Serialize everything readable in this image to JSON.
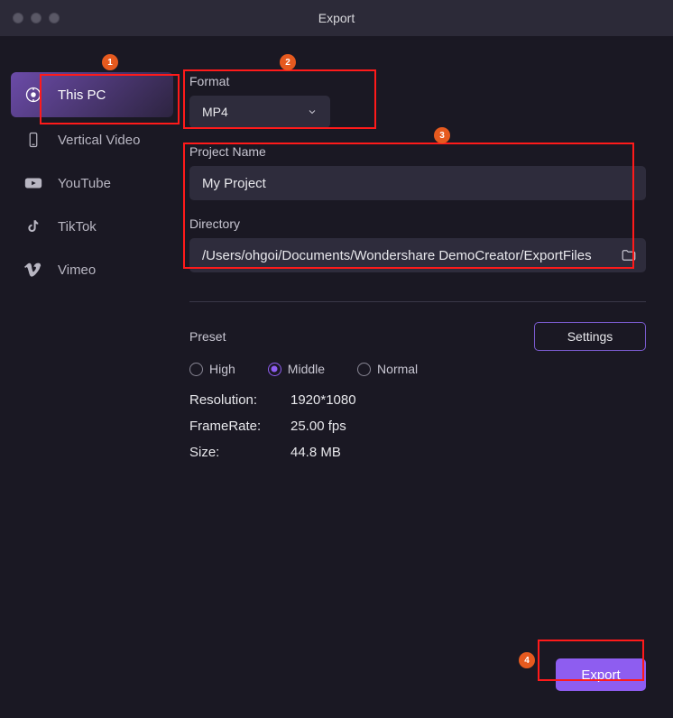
{
  "window": {
    "title": "Export"
  },
  "sidebar": {
    "items": [
      {
        "label": "This PC",
        "icon": "disk",
        "active": true
      },
      {
        "label": "Vertical Video",
        "icon": "phone",
        "active": false
      },
      {
        "label": "YouTube",
        "icon": "youtube",
        "active": false
      },
      {
        "label": "TikTok",
        "icon": "tiktok",
        "active": false
      },
      {
        "label": "Vimeo",
        "icon": "vimeo",
        "active": false
      }
    ]
  },
  "format": {
    "label": "Format",
    "value": "MP4"
  },
  "project": {
    "label": "Project Name",
    "value": "My Project"
  },
  "directory": {
    "label": "Directory",
    "value": "/Users/ohgoi/Documents/Wondershare DemoCreator/ExportFiles"
  },
  "preset": {
    "label": "Preset",
    "settings_label": "Settings",
    "options": [
      {
        "label": "High",
        "selected": false
      },
      {
        "label": "Middle",
        "selected": true
      },
      {
        "label": "Normal",
        "selected": false
      }
    ]
  },
  "info": {
    "resolution": {
      "label": "Resolution:",
      "value": "1920*1080"
    },
    "framerate": {
      "label": "FrameRate:",
      "value": "25.00 fps"
    },
    "size": {
      "label": "Size:",
      "value": "44.8 MB"
    }
  },
  "export_label": "Export",
  "annotations": {
    "badge1": "1",
    "badge2": "2",
    "badge3": "3",
    "badge4": "4"
  },
  "colors": {
    "accent": "#8e5df0",
    "highlight": "#ff1a1a",
    "badge": "#e65a1f",
    "bg": "#1a1823",
    "input_bg": "#2e2c3c"
  }
}
